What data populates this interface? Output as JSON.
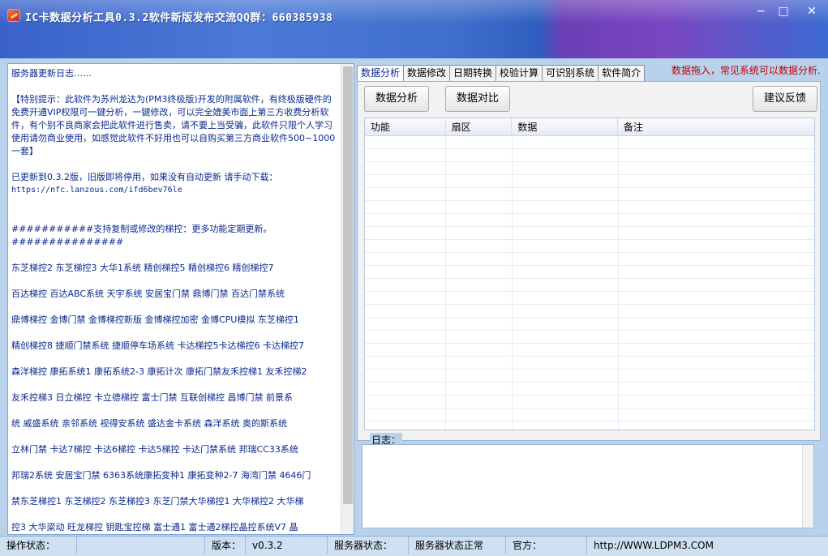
{
  "window": {
    "title": "IC卡数据分析工具0.3.2软件新版发布交流QQ群：660385938",
    "min": "−",
    "max": "□",
    "close": "✕"
  },
  "left": {
    "heading": "服务器更新日志……",
    "notice": "【特别提示：此软件为苏州龙达为(PM3终极版)开发的附属软件，有终极版硬件的免费开通VIP权限可一键分析，一键修改，可以完全媲美市面上第三方收费分析软件，有个别不良商家会把此软件进行售卖，请不要上当受骗，此软件只限个人学习使用请勿商业使用，如感觉此软件不好用也可以自购买第三方商业软件500~1000一套】",
    "update": "已更新到0.3.2版，旧版即将停用，如果没有自动更新 请手动下载：",
    "url": "https://nfc.lanzous.com/ifd6bev76le",
    "supported_header": "###########支持复制或修改的梯控：更多功能定期更新。###############",
    "lines": [
      "东芝梯控2 东芝梯控3 大华1系统 精创梯控5 精创梯控6 精创梯控7",
      "百达梯控 百达ABC系统 天宇系统 安居宝门禁 鼎博门禁 百达门禁系统",
      "鼎博梯控 金博门禁 金博梯控新版 金博梯控加密 金博CPU模拟 东芝梯控1",
      "精创梯控8 捷顺门禁系统 捷顺停车场系统 卡达梯控5卡达梯控6 卡达梯控7",
      "森洋梯控 康拓系统1 康拓系统2-3 康拓计次 康拓门禁友禾控梯1 友禾控梯2",
      "友禾控梯3 日立梯控 卡立德梯控  富士门禁 互联创梯控 昌博门禁 前景系",
      "统 威盛系统 亲邻系统 视得安系统  盛达金卡系统 森洋系统 奥的斯系统",
      "立林门禁 卡达7梯控 卡达6梯控 卡达5梯控 卡达门禁系统 邦瑞CC33系统",
      "邦瑞2系统 安居宝门禁 6363系统康拓变种1 康拓变种2-7 海湾门禁 4646门",
      "禁东芝梯控1 东芝梯控2 东芝梯控3 东芝门禁大华梯控1  大华梯控2 大华梯",
      "控3 大华梁动  旺龙梯控  钥匙宝控梯 富士通1 富士通2梯控晶控系统V7 晶"
    ]
  },
  "right": {
    "tabs": [
      "数据分析",
      "数据修改",
      "日期转换",
      "校验计算",
      "可识别系统",
      "软件简介"
    ],
    "hint": "数据拖入，常见系统可以数据分析.",
    "buttons": {
      "analyze": "数据分析",
      "compare": "数据对比",
      "feedback": "建议反馈"
    },
    "columns": [
      "功能",
      "扇区",
      "数据",
      "备注"
    ],
    "log_label": "日志："
  },
  "status": {
    "op_label": "操作状态：",
    "op_value": "",
    "version_label": "版本：",
    "version_value": "v0.3.2",
    "server_label": "服务器状态：",
    "server_value": "服务器状态正常",
    "official_label": "官方：",
    "official_value": "http://WWW.LDPM3.COM"
  }
}
